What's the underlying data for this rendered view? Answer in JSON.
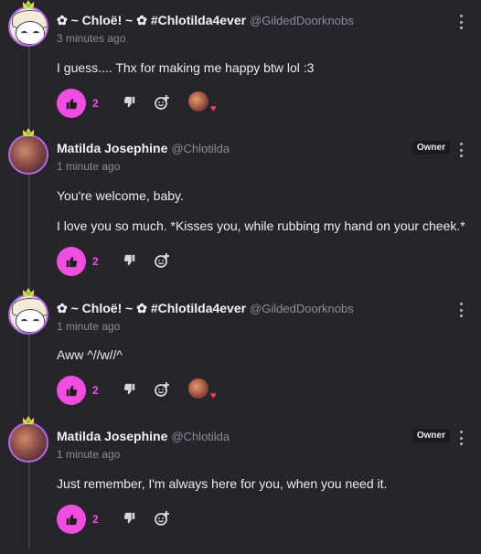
{
  "comments": [
    {
      "author": "✿ ~ Chloë! ~ ✿ #Chlotilda4ever",
      "handle": "@GildedDoorknobs",
      "time": "3 minutes ago",
      "lines": [
        "I guess.... Thx for making me happy btw lol :3"
      ],
      "likes": "2",
      "owner": "",
      "has_reaction": true
    },
    {
      "author": "Matilda Josephine",
      "handle": "@Chlotilda",
      "time": "1 minute ago",
      "lines": [
        "You're welcome, baby.",
        "I love you so much. *Kisses you, while rubbing my hand on your cheek.*"
      ],
      "likes": "2",
      "owner": "Owner",
      "has_reaction": false
    },
    {
      "author": "✿ ~ Chloë! ~ ✿ #Chlotilda4ever",
      "handle": "@GildedDoorknobs",
      "time": "1 minute ago",
      "lines": [
        "Aww ^//w//^"
      ],
      "likes": "2",
      "owner": "",
      "has_reaction": true
    },
    {
      "author": "Matilda Josephine",
      "handle": "@Chlotilda",
      "time": "1 minute ago",
      "lines": [
        "Just remember, I'm always here for you, when you need it."
      ],
      "likes": "2",
      "owner": "Owner",
      "has_reaction": false
    }
  ],
  "icons": {
    "like": "thumbs-up-icon",
    "dislike": "thumbs-down-icon",
    "react": "add-reaction-icon",
    "menu": "more-vertical-icon",
    "reaction": "heart-icon"
  },
  "colors": {
    "accent": "#f04ee0",
    "background": "#27252b",
    "heart": "#ff3c5a"
  }
}
